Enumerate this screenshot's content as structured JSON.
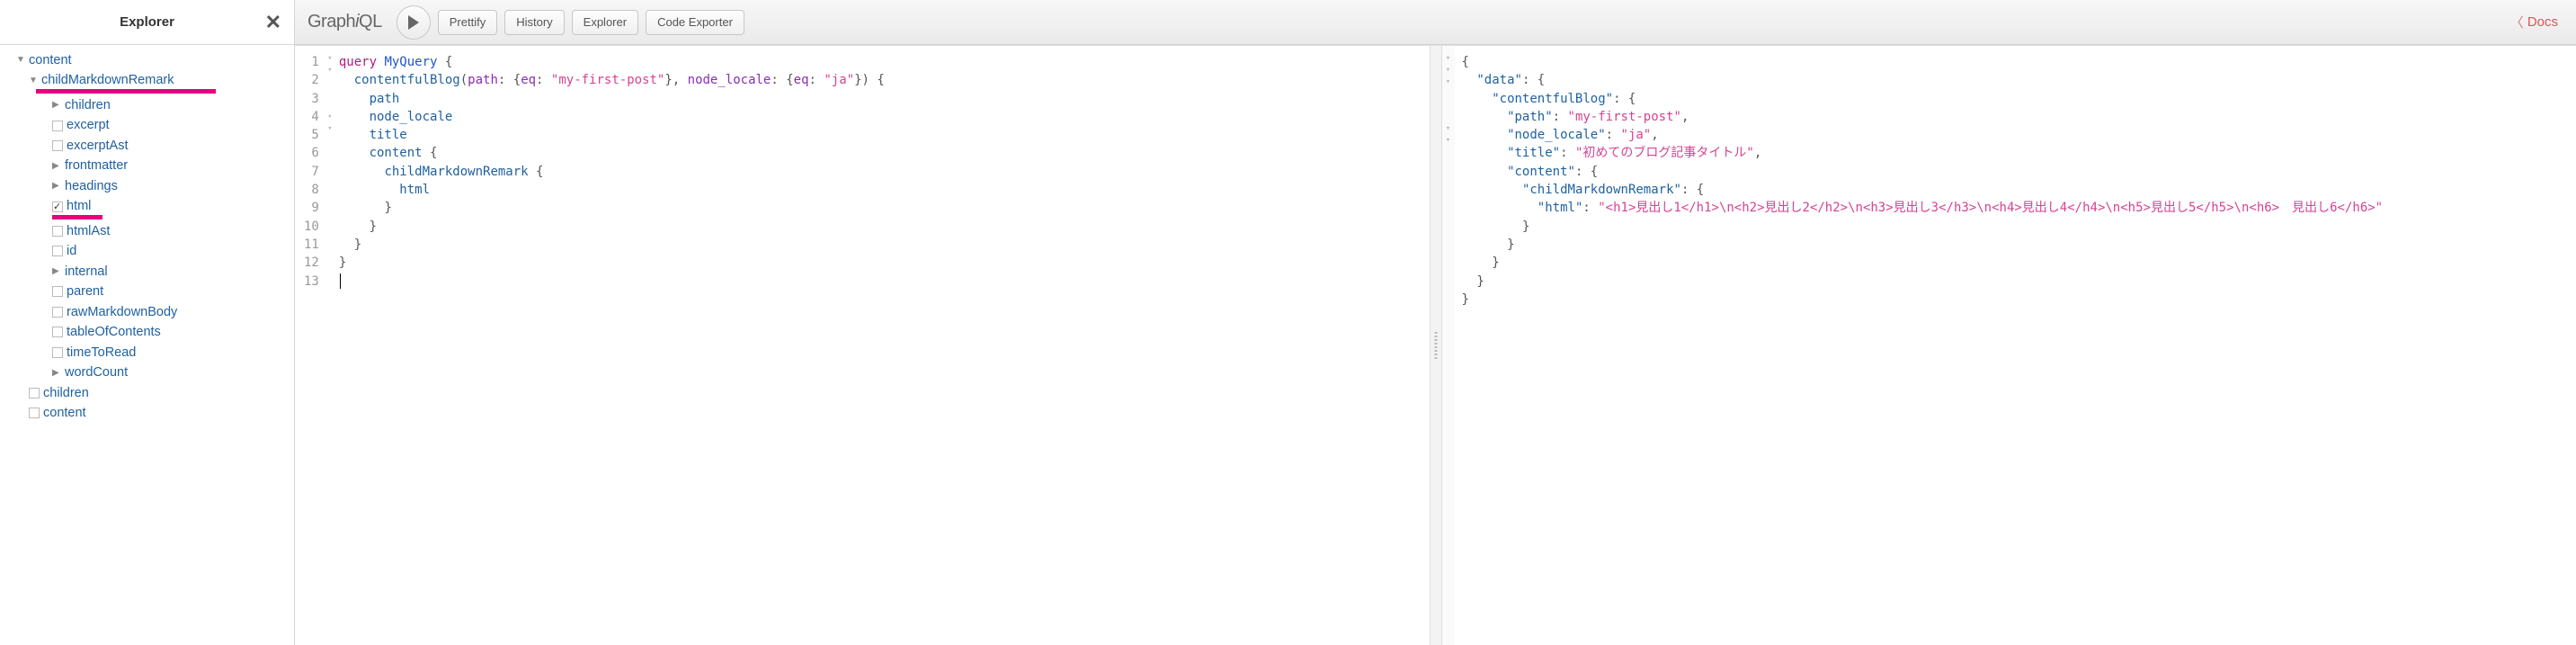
{
  "explorer": {
    "title": "Explorer",
    "tree": {
      "root": "content",
      "child": "childMarkdownRemark",
      "fields": {
        "children": "children",
        "excerpt": "excerpt",
        "excerptAst": "excerptAst",
        "frontmatter": "frontmatter",
        "headings": "headings",
        "html": "html",
        "htmlAst": "htmlAst",
        "id": "id",
        "internal": "internal",
        "parent": "parent",
        "rawMarkdownBody": "rawMarkdownBody",
        "tableOfContents": "tableOfContents",
        "timeToRead": "timeToRead",
        "wordCount": "wordCount"
      },
      "siblings": {
        "children": "children",
        "content": "content"
      }
    }
  },
  "topbar": {
    "logo_plain1": "Graph",
    "logo_i": "i",
    "logo_plain2": "QL",
    "prettify": "Prettify",
    "history": "History",
    "explorer": "Explorer",
    "code_exporter": "Code Exporter",
    "docs": "Docs"
  },
  "query": {
    "lines": [
      "1",
      "2",
      "3",
      "4",
      "5",
      "6",
      "7",
      "8",
      "9",
      "10",
      "11",
      "12",
      "13"
    ],
    "kw_query": "query",
    "name": "MyQuery",
    "root_field": "contentfulBlog",
    "arg_path": "path",
    "arg_eq1": "eq",
    "val_path": "\"my-first-post\"",
    "arg_locale": "node_locale",
    "arg_eq2": "eq",
    "val_locale": "\"ja\"",
    "f_path": "path",
    "f_locale": "node_locale",
    "f_title": "title",
    "f_content": "content",
    "f_cmr": "childMarkdownRemark",
    "f_html": "html"
  },
  "chart_data": {
    "type": "table",
    "query_text": "query MyQuery {\n  contentfulBlog(path: {eq: \"my-first-post\"}, node_locale: {eq: \"ja\"}) {\n    path\n    node_locale\n    title\n    content {\n      childMarkdownRemark {\n        html\n      }\n    }\n  }\n}",
    "result": {
      "data": {
        "contentfulBlog": {
          "path": "my-first-post",
          "node_locale": "ja",
          "title": "初めてのブログ記事タイトル",
          "content": {
            "childMarkdownRemark": {
              "html": "<h1>見出し1</h1>\\n<h2>見出し2</h2>\\n<h3>見出し3</h3>\\n<h4>見出し4</h4>\\n<h5>見出し5</h5>\\n<h6>　見出し6</h6>"
            }
          }
        }
      }
    }
  },
  "result": {
    "k_data": "\"data\"",
    "k_blog": "\"contentfulBlog\"",
    "k_path": "\"path\"",
    "v_path": "\"my-first-post\"",
    "k_locale": "\"node_locale\"",
    "v_locale": "\"ja\"",
    "k_title": "\"title\"",
    "v_title": "\"初めてのブログ記事タイトル\"",
    "k_content": "\"content\"",
    "k_cmr": "\"childMarkdownRemark\"",
    "k_html": "\"html\"",
    "v_html": "\"<h1>見出し1</h1>\\n<h2>見出し2</h2>\\n<h3>見出し3</h3>\\n<h4>見出し4</h4>\\n<h5>見出し5</h5>\\n<h6>　見出し6</h6>\""
  }
}
